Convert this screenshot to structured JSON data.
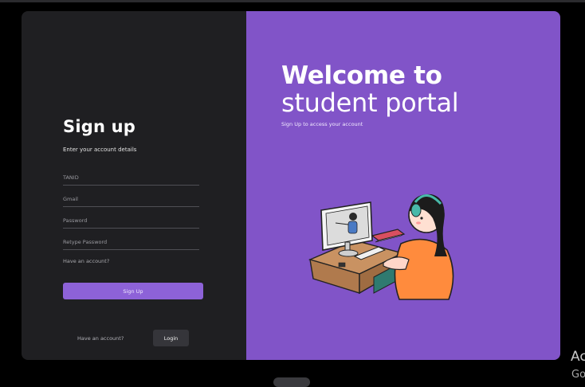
{
  "left_panel": {
    "title": "Sign up",
    "subtitle": "Enter your account details",
    "fields": {
      "tanid_placeholder": "TANID",
      "gmail_placeholder": "Gmail",
      "password_placeholder": "Password",
      "retype_password_placeholder": "Retype Password"
    },
    "have_account_hint": "Have an account?",
    "signup_label": "Sign Up",
    "footer_text": "Have an account?",
    "login_label": "Login"
  },
  "right_panel": {
    "headline_line1": "Welcome to",
    "headline_line2": "student portal",
    "subtitle": "Sign Up to access your account"
  },
  "desktop": {
    "corner_line1": "Ac",
    "corner_line2": "Go"
  },
  "colors": {
    "left_bg": "#1f1f22",
    "accent_purple": "#8154c8",
    "button_purple": "#8d62d8",
    "login_button": "#35353a"
  },
  "icons": [
    "student-laptop-illustration"
  ]
}
